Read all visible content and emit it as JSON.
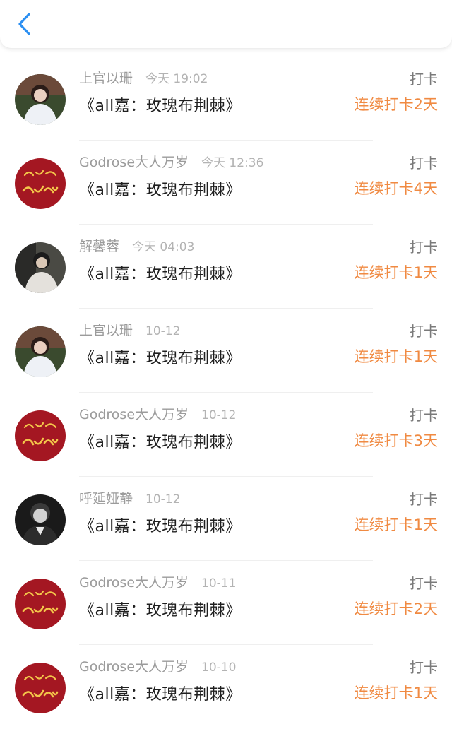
{
  "header": {
    "back_icon": "chevron-left-icon",
    "accent": "#2b8ff2"
  },
  "colors": {
    "streak": "#f08a42",
    "muted": "#9b9b9b"
  },
  "feed": [
    {
      "user": "上官以珊",
      "time": "今天 19:02",
      "title": "《all嘉：玫瑰布荆棘》",
      "action": "打卡",
      "streak": "连续打卡2天",
      "avatar": "girl-photo"
    },
    {
      "user": "Godrose大人万岁",
      "time": "今天 12:36",
      "title": "《all嘉：玫瑰布荆棘》",
      "action": "打卡",
      "streak": "连续打卡4天",
      "avatar": "red-calligraphy"
    },
    {
      "user": "解馨蓉",
      "time": "今天 04:03",
      "title": "《all嘉：玫瑰布荆棘》",
      "action": "打卡",
      "streak": "连续打卡1天",
      "avatar": "boy-photo"
    },
    {
      "user": "上官以珊",
      "time": "10-12",
      "title": "《all嘉：玫瑰布荆棘》",
      "action": "打卡",
      "streak": "连续打卡1天",
      "avatar": "girl-photo"
    },
    {
      "user": "Godrose大人万岁",
      "time": "10-12",
      "title": "《all嘉：玫瑰布荆棘》",
      "action": "打卡",
      "streak": "连续打卡3天",
      "avatar": "red-calligraphy"
    },
    {
      "user": "呼延娅静",
      "time": "10-12",
      "title": "《all嘉：玫瑰布荆棘》",
      "action": "打卡",
      "streak": "连续打卡1天",
      "avatar": "bw-portrait"
    },
    {
      "user": "Godrose大人万岁",
      "time": "10-11",
      "title": "《all嘉：玫瑰布荆棘》",
      "action": "打卡",
      "streak": "连续打卡2天",
      "avatar": "red-calligraphy"
    },
    {
      "user": "Godrose大人万岁",
      "time": "10-10",
      "title": "《all嘉：玫瑰布荆棘》",
      "action": "打卡",
      "streak": "连续打卡1天",
      "avatar": "red-calligraphy"
    }
  ]
}
